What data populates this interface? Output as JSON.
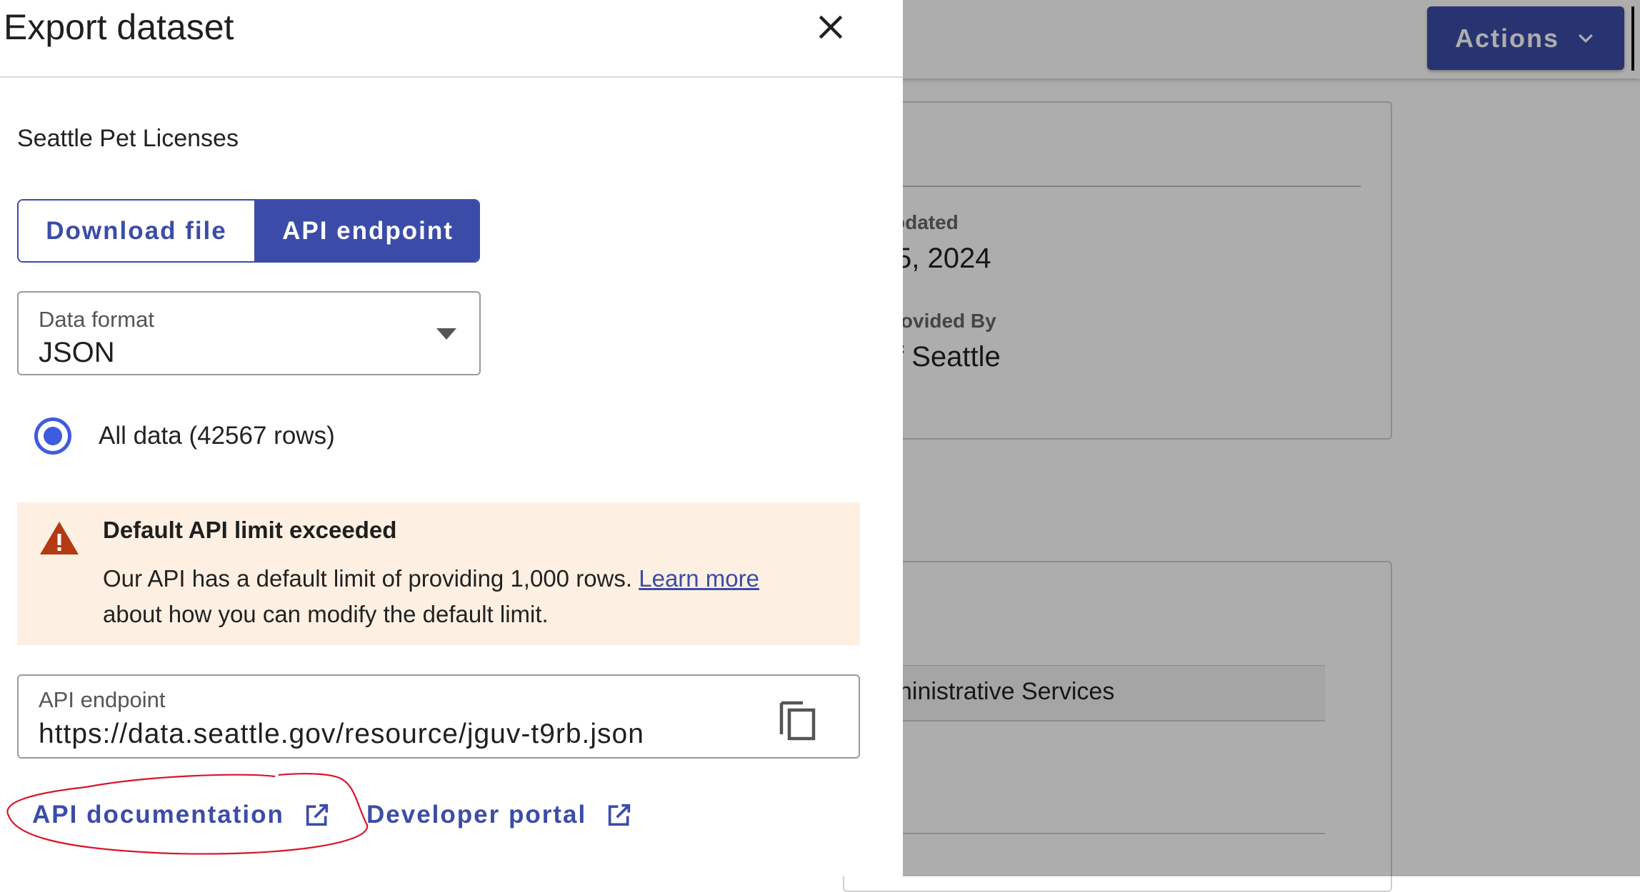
{
  "background": {
    "actions_label": "Actions",
    "meta_label_1": "odated",
    "meta_value_1": "5, 2024",
    "meta_label_2": "rovided By",
    "meta_value_2": "f Seattle",
    "row_text": "ninistrative Services"
  },
  "dialog": {
    "title": "Export dataset",
    "dataset_name": "Seattle Pet Licenses",
    "tabs": [
      {
        "label": "Download file",
        "selected": false
      },
      {
        "label": "API endpoint",
        "selected": true
      }
    ],
    "format": {
      "label": "Data format",
      "value": "JSON"
    },
    "radio_label": "All data (42567 rows)",
    "alert": {
      "title": "Default API limit exceeded",
      "body_before": "Our API has a default limit of providing 1,000 rows.",
      "link": "Learn more",
      "body_after": "about how you can modify the default limit."
    },
    "endpoint": {
      "label": "API endpoint",
      "value": "https://data.seattle.gov/resource/jguv-t9rb.json"
    },
    "links": {
      "api_docs": "API documentation",
      "developer_portal": "Developer portal"
    }
  },
  "colors": {
    "accent": "#3b4ca8",
    "radio": "#3f5be0",
    "alert_bg": "#fdf0e2",
    "warning_icon": "#b33a12",
    "annotation": "#d9142a"
  }
}
